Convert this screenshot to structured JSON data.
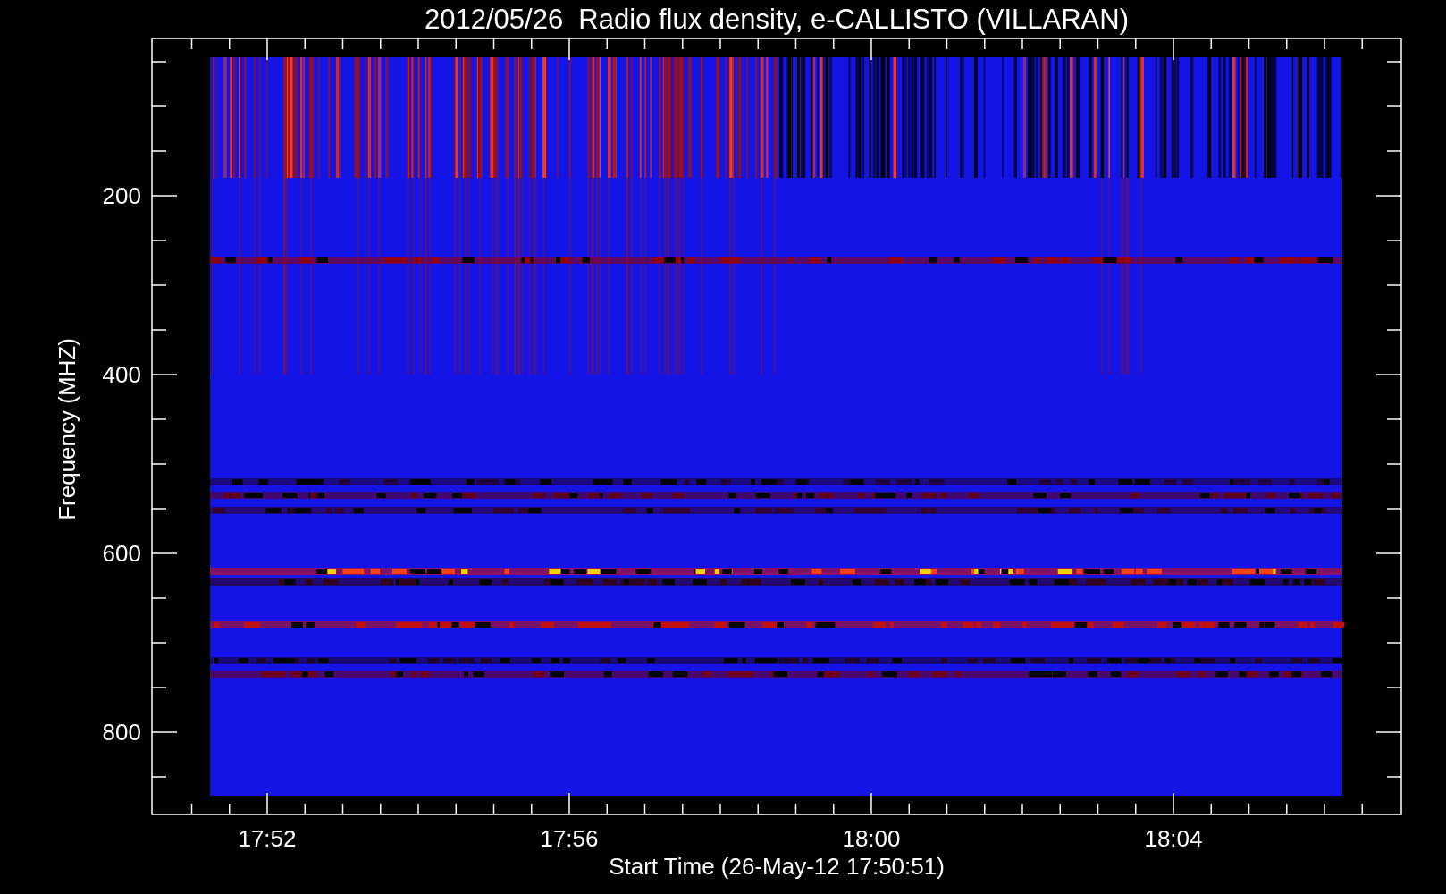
{
  "title": "2012/05/26  Radio flux density, e-CALLISTO (VILLARAN)",
  "y_axis": {
    "label": "Frequency (MHZ)",
    "ticks": [
      "200",
      "400",
      "600",
      "800"
    ]
  },
  "x_axis": {
    "label": "Start Time (26-May-12 17:50:51)",
    "ticks": [
      "17:52",
      "17:56",
      "18:00",
      "18:04"
    ]
  }
}
